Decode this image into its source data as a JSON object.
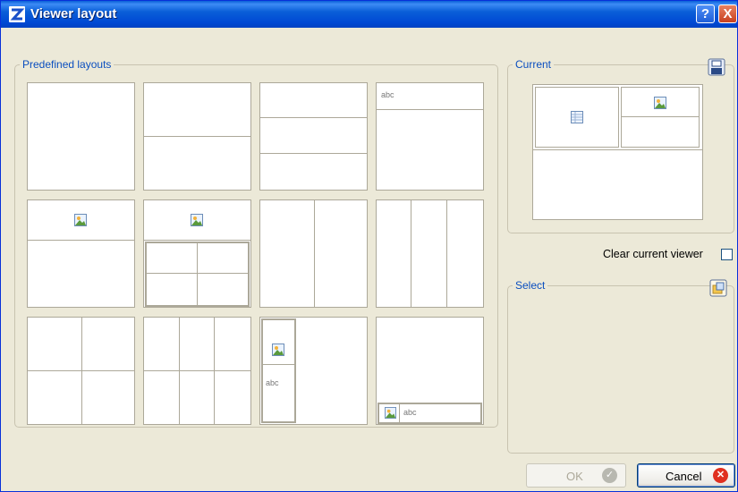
{
  "window": {
    "title": "Viewer layout",
    "help_label": "?",
    "close_label": "X"
  },
  "predefined": {
    "legend": "Predefined layouts",
    "abc": "abc"
  },
  "current": {
    "legend": "Current"
  },
  "clear_current_viewer": {
    "label": "Clear current viewer",
    "checked": false
  },
  "select": {
    "legend": "Select"
  },
  "buttons": {
    "ok_label": "OK",
    "cancel_label": "Cancel"
  },
  "colors": {
    "legend_blue": "#0a4ebf",
    "titlebar_blue": "#0a5fd8",
    "dialog_bg": "#ece9d8"
  }
}
